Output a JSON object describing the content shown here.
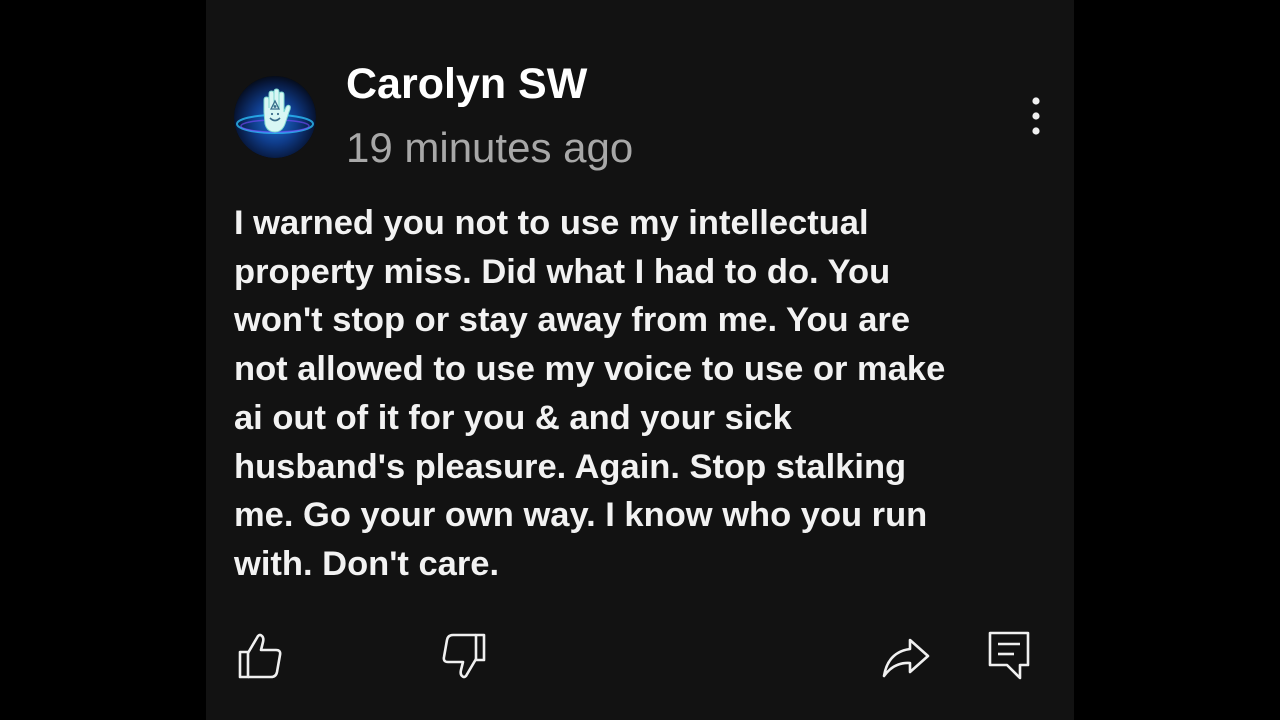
{
  "comment": {
    "author": "Carolyn SW",
    "timestamp": "19 minutes ago",
    "body_lines": [
      "I warned you not to use my intellectual",
      "property miss. Did what I had to do. You",
      "won't stop or stay away from me. You are",
      "not allowed to use my voice to use or make",
      "ai out of it for you & and your sick",
      "husband's pleasure. Again. Stop stalking",
      "me. Go your own way. I know who you run",
      "with. Don't care."
    ],
    "avatar_icon": "hamsa-hand-icon"
  },
  "actions": {
    "more_icon": "more-vertical-icon",
    "like_icon": "thumbs-up-icon",
    "dislike_icon": "thumbs-down-icon",
    "share_icon": "share-arrow-icon",
    "reply_icon": "comment-icon"
  },
  "colors": {
    "background": "#000000",
    "panel": "#121212",
    "author_text": "#ffffff",
    "timestamp_text": "#a8a8a8",
    "body_text": "#f2f2f2",
    "icon": "#f0f0f0"
  }
}
